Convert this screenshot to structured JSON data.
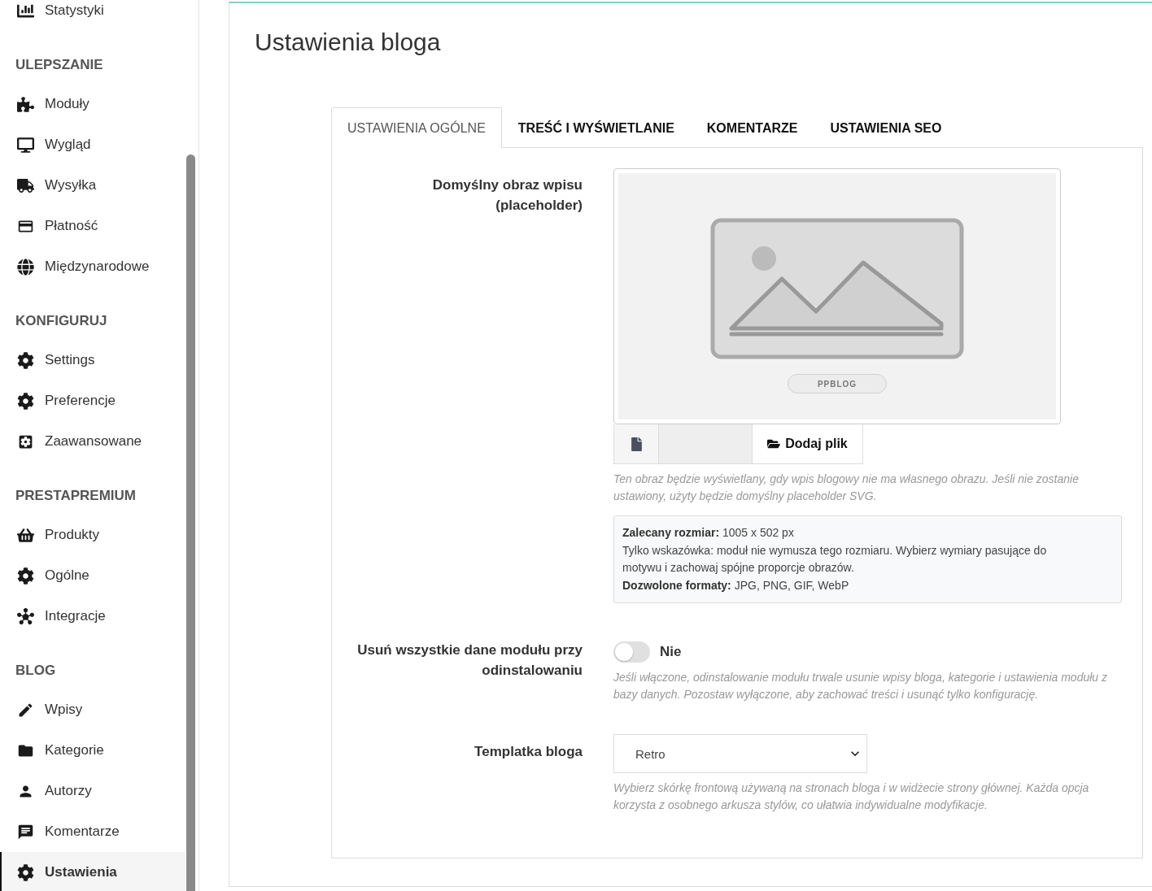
{
  "sidebar": {
    "groups": [
      {
        "items": [
          {
            "label": "Statystyki",
            "selected": false
          }
        ]
      },
      {
        "heading": "ULEPSZANIE",
        "items": [
          {
            "label": "Moduły",
            "selected": false
          },
          {
            "label": "Wygląd",
            "selected": false
          },
          {
            "label": "Wysyłka",
            "selected": false
          },
          {
            "label": "Płatność",
            "selected": false
          },
          {
            "label": "Międzynarodowe",
            "selected": false
          }
        ]
      },
      {
        "heading": "KONFIGURUJ",
        "items": [
          {
            "label": "Settings",
            "selected": false
          },
          {
            "label": "Preferencje",
            "selected": false
          },
          {
            "label": "Zaawansowane",
            "selected": false
          }
        ]
      },
      {
        "heading": "PRESTAPREMIUM",
        "items": [
          {
            "label": "Produkty",
            "selected": false
          },
          {
            "label": "Ogólne",
            "selected": false
          },
          {
            "label": "Integracje",
            "selected": false
          }
        ]
      },
      {
        "heading": "BLOG",
        "items": [
          {
            "label": "Wpisy",
            "selected": false
          },
          {
            "label": "Kategorie",
            "selected": false
          },
          {
            "label": "Autorzy",
            "selected": false
          },
          {
            "label": "Komentarze",
            "selected": false
          },
          {
            "label": "Ustawienia",
            "selected": true
          }
        ]
      }
    ]
  },
  "page": {
    "title": "Ustawienia bloga"
  },
  "tabs": [
    {
      "label": "USTAWIENIA OGÓLNE",
      "selected": true
    },
    {
      "label": "TREŚĆ I WYŚWIETLANIE",
      "selected": false
    },
    {
      "label": "KOMENTARZE",
      "selected": false
    },
    {
      "label": "USTAWIENIA SEO",
      "selected": false
    }
  ],
  "fields": [
    {
      "kind": "image",
      "label": "Domyślny obraz wpisu (placeholder)",
      "preview_badge": "PPBLOG",
      "button": "Dodaj plik",
      "help": "Ten obraz będzie wyświetlany, gdy wpis blogowy nie ma własnego obrazu. Jeśli nie zostanie ustawiony, użyty będzie domyślny placeholder SVG.",
      "info": [
        "**Zalecany rozmiar:** 1005 x 502 px",
        "Tylko wskazówka: moduł nie wymusza tego rozmiaru. Wybierz wymiary pasujące do motywu i zachowaj spójne proporcje obrazów.",
        "**Dozwolone formaty:** JPG, PNG, GIF, WebP"
      ]
    },
    {
      "kind": "toggle",
      "label": "Usuń wszystkie dane modułu przy odinstalowaniu",
      "on": false,
      "state_label": "Nie",
      "help": "Jeśli włączone, odinstalowanie modułu trwale usunie wpisy bloga, kategorie i ustawienia modułu z bazy danych. Pozostaw wyłączone, aby zachować treści i usunąć tylko konfigurację."
    },
    {
      "kind": "select",
      "label": "Templatka bloga",
      "value": "Retro",
      "help": "Wybierz skórkę frontową używaną na stronach bloga i w widżecie strony głównej. Każda opcja korzysta z osobnego arkusza stylów, co ułatwia indywidualne modyfikacje."
    }
  ]
}
